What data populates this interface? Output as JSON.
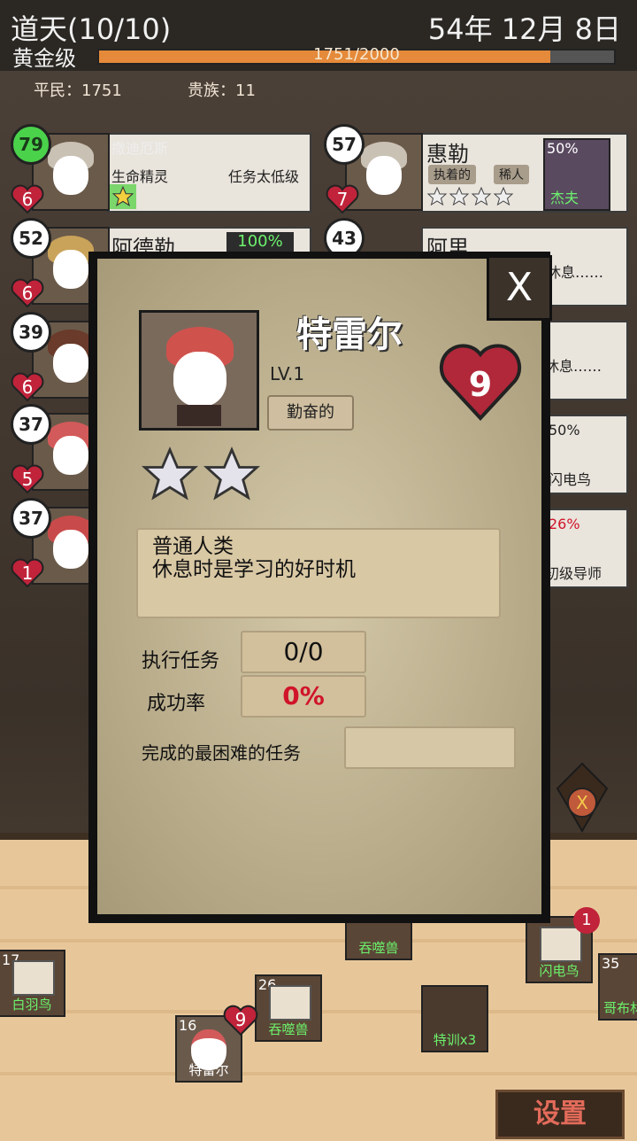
{
  "header": {
    "title": "道天(10/10)",
    "date": "54年 12月 8日",
    "rank": "黄金级",
    "progress_text": "1751/2000",
    "progress_value": 0.8755
  },
  "population": {
    "commoners": "平民：1751",
    "nobles": "贵族：11"
  },
  "heroes": [
    {
      "level": "79",
      "hearts": "6",
      "name": "撒迪厄斯",
      "race": "生命精灵",
      "note": "任务太低级"
    },
    {
      "level": "57",
      "hearts": "7",
      "name": "惠勒",
      "tag1": "执着的",
      "tag2": "稀人",
      "side_percent": "50%",
      "side_name": "杰夫"
    },
    {
      "level": "52",
      "hearts": "6",
      "name": "阿德勒",
      "percent": "100%"
    },
    {
      "level": "43",
      "name": "阿里",
      "status": "休息……"
    },
    {
      "level": "39",
      "hearts": "6"
    },
    {
      "level": "37",
      "hearts": "5"
    },
    {
      "level": "37",
      "hearts": "1"
    }
  ],
  "right_side": {
    "rest2": "休息……",
    "item1_percent": "50%",
    "item1_name": "闪电鸟",
    "item2_percent": "26%",
    "item2_name": "初级导师"
  },
  "modal": {
    "close_label": "X",
    "hero_name": "特雷尔",
    "level": "LV.1",
    "trait": "勤奋的",
    "hearts": "9",
    "stars": 2,
    "description_line1": "普通人类",
    "description_line2": "休息时是学习的好时机",
    "tasks_label": "执行任务",
    "tasks_value": "0/0",
    "success_label": "成功率",
    "success_value": "0%",
    "hardest_label": "完成的最困难的任务",
    "hardest_value": ""
  },
  "floor_items": [
    {
      "count": "17",
      "name": "白羽鸟"
    },
    {
      "count": "",
      "name": "吞噬兽"
    },
    {
      "count": "26",
      "name": "吞噬兽"
    },
    {
      "count": "16",
      "name": "特雷尔",
      "hearts": "9"
    },
    {
      "count": "",
      "name": "特训x3"
    },
    {
      "count": "",
      "name": "闪电鸟",
      "badge": "1"
    },
    {
      "count": "35",
      "name": "哥布林"
    }
  ],
  "settings_label": "设置",
  "colors": {
    "accent": "#e58a3a",
    "danger": "#d0142a",
    "level_green": "#4bd24b"
  }
}
